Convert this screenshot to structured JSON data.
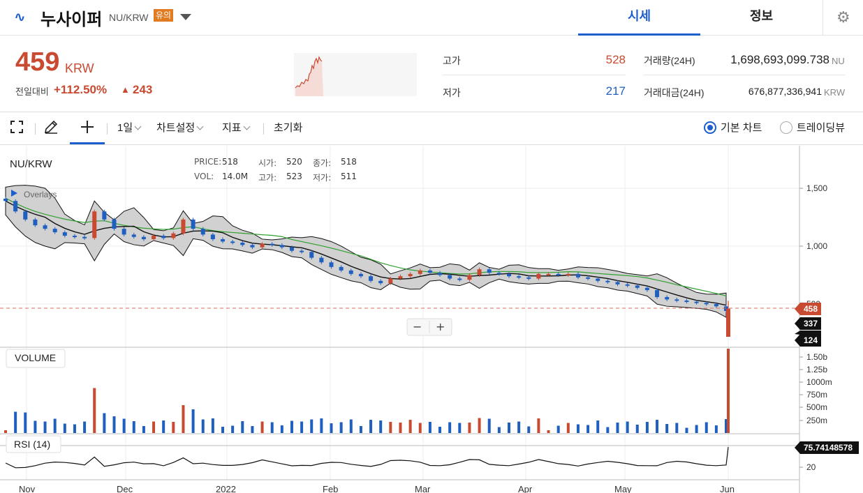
{
  "header": {
    "logo_glyph": "∿",
    "coin_name": "누사이퍼",
    "pair": "NU/KRW",
    "warning_badge": "유의",
    "tabs": [
      "시세",
      "정보"
    ]
  },
  "summary": {
    "price": "459",
    "unit": "KRW",
    "change_label": "전일대비",
    "change_pct": "+112.50%",
    "change_arrow": "▲",
    "change_abs": "243",
    "high_label": "고가",
    "high_value": "528",
    "low_label": "저가",
    "low_value": "217",
    "volume_label": "거래량(24H)",
    "volume_value": "1,698,693,099.738",
    "volume_unit": "NU",
    "amount_label": "거래대금(24H)",
    "amount_value": "676,877,336,941",
    "amount_unit": "KRW"
  },
  "toolbar": {
    "interval": "1일",
    "chart_settings": "차트설정",
    "indicators": "지표",
    "reset": "초기화",
    "basic_chart": "기본 차트",
    "trading_view": "트레이딩뷰",
    "basic_selected": true
  },
  "chart_info": {
    "symbol": "NU/KRW",
    "overlays": "Overlays",
    "price_label": "PRICE:",
    "price_value": "518",
    "open_label": "시가:",
    "open_value": "520",
    "close_label": "종가:",
    "close_value": "518",
    "vol_label": "VOL:",
    "vol_value": "14.0M",
    "high_label": "고가:",
    "high_value": "523",
    "low_label": "저가:",
    "low_value": "511",
    "volume_pane": "VOLUME",
    "rsi_pane": "RSI (14)"
  },
  "colors": {
    "accent": "#1b5fcf",
    "up": "#c84a31",
    "down": "#1f5fbf",
    "ma_long": "#2ea02e",
    "band_fill": "#c9c9c9"
  },
  "chart_data": {
    "type": "candlestick",
    "price_axis_ticks": [
      "1,500",
      "1,000",
      "500"
    ],
    "price_ylim": [
      300,
      1850
    ],
    "price_markers": [
      {
        "label": "458",
        "value": 458,
        "color": "#c84a31"
      },
      {
        "label": "337",
        "value": 337,
        "color": "#111111"
      },
      {
        "label": "124",
        "value": 124,
        "color": "#111111"
      }
    ],
    "volume_axis_ticks": [
      "1.50b",
      "1.25b",
      "1000m",
      "750m",
      "500m",
      "250m"
    ],
    "rsi_axis_ticks": [
      "20"
    ],
    "rsi_current": "75.74148578",
    "x_axis_labels": [
      "Nov",
      "Dec",
      "2022",
      "Feb",
      "Mar",
      "Apr",
      "May",
      "Jun"
    ],
    "close_series": [
      1390,
      1300,
      1230,
      1180,
      1150,
      1120,
      1090,
      1080,
      1070,
      1300,
      1230,
      1150,
      1100,
      1080,
      1060,
      1090,
      1070,
      1110,
      1230,
      1150,
      1100,
      1060,
      1040,
      1030,
      1010,
      990,
      1020,
      1010,
      990,
      960,
      950,
      900,
      860,
      820,
      790,
      760,
      740,
      700,
      680,
      720,
      740,
      760,
      790,
      770,
      750,
      720,
      710,
      750,
      800,
      770,
      760,
      740,
      730,
      720,
      760,
      760,
      750,
      760,
      730,
      720,
      700,
      690,
      670,
      660,
      640,
      620,
      560,
      540,
      530,
      520,
      510,
      500,
      480,
      440
    ]
  },
  "pan_controls": {
    "zoom_out": "−",
    "zoom_in": "+"
  }
}
